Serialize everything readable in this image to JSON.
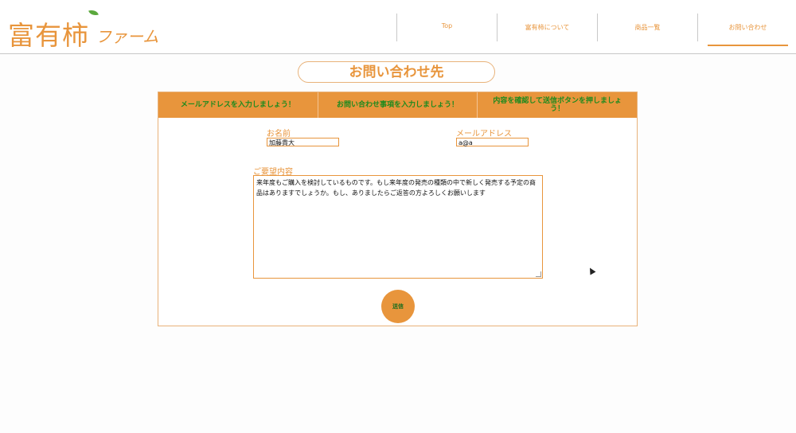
{
  "header": {
    "logo_main": "富有柿",
    "logo_sub": "ファーム",
    "nav": [
      {
        "label": "Top"
      },
      {
        "label": "富有柿について"
      },
      {
        "label": "商品一覧"
      },
      {
        "label": "お問い合わせ",
        "active": true
      }
    ]
  },
  "page_title": "お問い合わせ先",
  "steps": [
    "メールアドレスを入力しましょう！",
    "お問い合わせ事項を入力しましょう！",
    "内容を確認して送信ボタンを押しましょう！"
  ],
  "form": {
    "name_label": "お名前",
    "name_value": "加藤貴大",
    "email_label": "メールアドレス",
    "email_value": "a@a",
    "message_label": "ご要望内容",
    "message_value": "来年度もご購入を検討しているものです。もし来年度の発売の種類の中で新しく発売する予定の商品はありますでしょうか。もし、ありましたらご返答の方よろしくお願いします",
    "submit_label": "送信"
  },
  "colors": {
    "accent": "#e8953c",
    "step_text": "#1e8a1e"
  }
}
